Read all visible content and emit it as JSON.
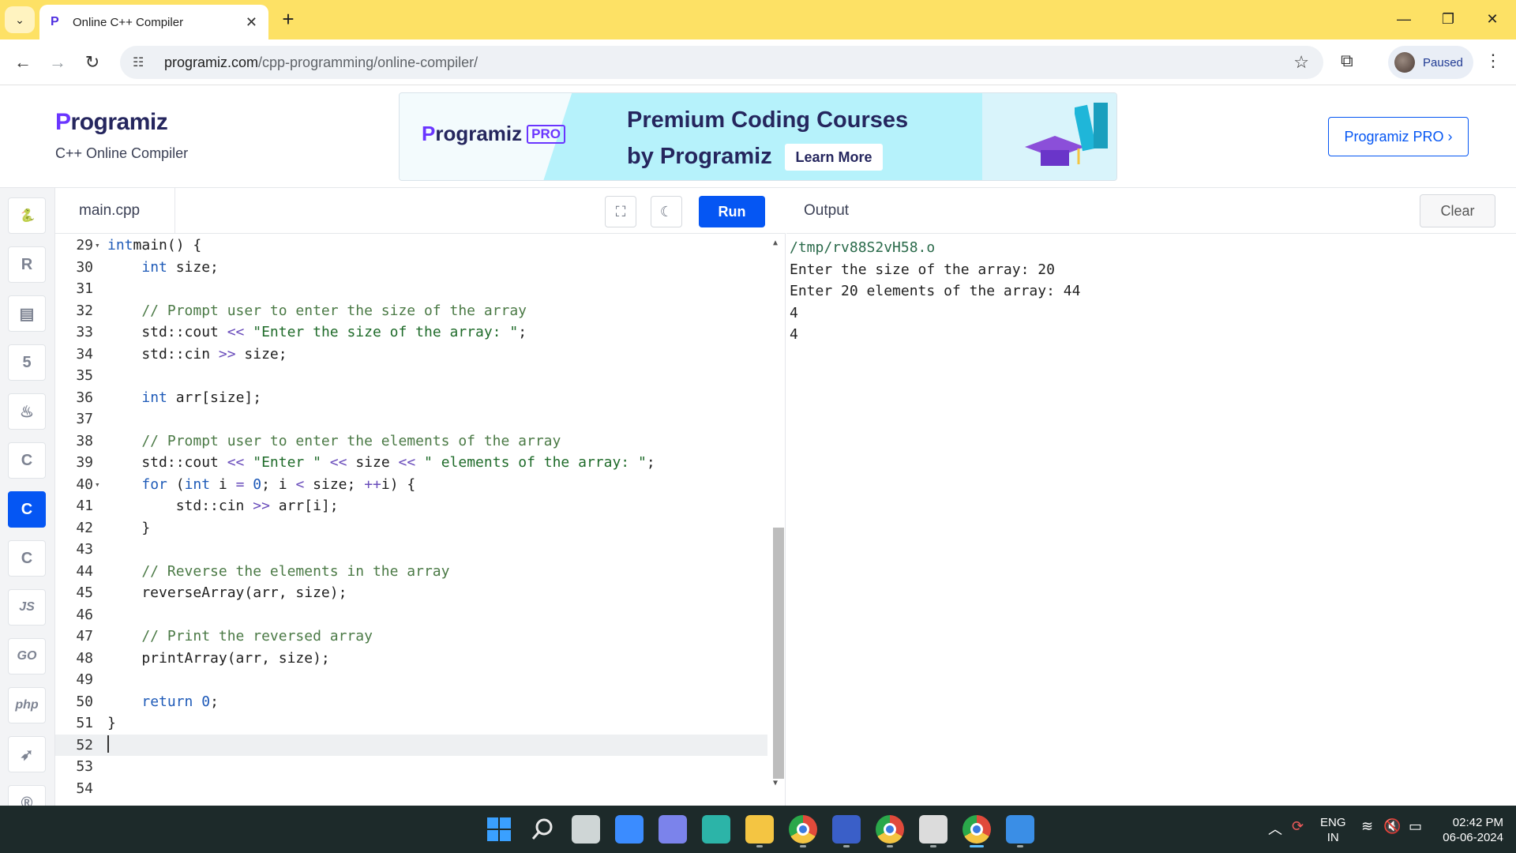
{
  "browser": {
    "tab_title": "Online C++ Compiler",
    "url_domain": "programiz.com",
    "url_path": "/cpp-programming/online-compiler/",
    "profile_status": "Paused",
    "titlebar_color": "#fde165"
  },
  "site": {
    "logo": "rogramiz",
    "logo_letter": "P",
    "subtitle": "C++ Online Compiler",
    "banner": {
      "logo": "rogramiz",
      "logo_letter": "P",
      "badge": "PRO",
      "headline_1": "Premium Coding Courses",
      "headline_2": "by Programiz",
      "cta": "Learn More"
    },
    "pro_button": "Programiz PRO ›"
  },
  "rail": {
    "languages": [
      {
        "name": "python-icon",
        "glyph": "🐍"
      },
      {
        "name": "r-icon",
        "glyph": "R"
      },
      {
        "name": "sql-icon",
        "glyph": "▤"
      },
      {
        "name": "html-icon",
        "glyph": "5"
      },
      {
        "name": "java-icon",
        "glyph": "♨"
      },
      {
        "name": "c-icon",
        "glyph": "C"
      },
      {
        "name": "cpp-icon",
        "glyph": "C",
        "active": true
      },
      {
        "name": "csharp-icon",
        "glyph": "C"
      },
      {
        "name": "js-icon",
        "glyph": "JS"
      },
      {
        "name": "go-icon",
        "glyph": "GO"
      },
      {
        "name": "php-icon",
        "glyph": "php"
      },
      {
        "name": "swift-icon",
        "glyph": "➶"
      },
      {
        "name": "rust-icon",
        "glyph": "®"
      }
    ]
  },
  "editor": {
    "file_name": "main.cpp",
    "run_label": "Run",
    "accent": "#0556f3",
    "current_line": 52,
    "lines": [
      {
        "n": "29",
        "fold": true,
        "tokens": [
          [
            "kw",
            "int"
          ],
          [
            "",
            "main() {"
          ]
        ]
      },
      {
        "n": "30",
        "fold": false,
        "tokens": [
          [
            "",
            "    "
          ],
          [
            "kw",
            "int"
          ],
          [
            "",
            " size;"
          ]
        ]
      },
      {
        "n": "31",
        "fold": false,
        "tokens": []
      },
      {
        "n": "32",
        "fold": false,
        "tokens": [
          [
            "com",
            "    // Prompt user to enter the size of the array"
          ]
        ]
      },
      {
        "n": "33",
        "fold": false,
        "tokens": [
          [
            "",
            "    std::cout "
          ],
          [
            "op",
            "<<"
          ],
          [
            "str",
            " \"Enter the size of the array: \""
          ],
          [
            "",
            ";"
          ]
        ]
      },
      {
        "n": "34",
        "fold": false,
        "tokens": [
          [
            "",
            "    std::cin "
          ],
          [
            "op",
            ">>"
          ],
          [
            "",
            " size;"
          ]
        ]
      },
      {
        "n": "35",
        "fold": false,
        "tokens": []
      },
      {
        "n": "36",
        "fold": false,
        "tokens": [
          [
            "",
            "    "
          ],
          [
            "kw",
            "int"
          ],
          [
            "",
            " arr[size];"
          ]
        ]
      },
      {
        "n": "37",
        "fold": false,
        "tokens": []
      },
      {
        "n": "38",
        "fold": false,
        "tokens": [
          [
            "com",
            "    // Prompt user to enter the elements of the array"
          ]
        ]
      },
      {
        "n": "39",
        "fold": false,
        "tokens": [
          [
            "",
            "    std::cout "
          ],
          [
            "op",
            "<<"
          ],
          [
            "str",
            " \"Enter \""
          ],
          [
            "",
            " "
          ],
          [
            "op",
            "<<"
          ],
          [
            "",
            " size "
          ],
          [
            "op",
            "<<"
          ],
          [
            "str",
            " \" elements of the array: \""
          ],
          [
            "",
            ";"
          ]
        ]
      },
      {
        "n": "40",
        "fold": true,
        "tokens": [
          [
            "",
            "    "
          ],
          [
            "kw",
            "for"
          ],
          [
            "",
            " ("
          ],
          [
            "kw",
            "int"
          ],
          [
            "",
            " i "
          ],
          [
            "op",
            "="
          ],
          [
            "",
            " "
          ],
          [
            "num",
            "0"
          ],
          [
            "",
            "; i "
          ],
          [
            "op",
            "<"
          ],
          [
            "",
            " size; "
          ],
          [
            "op",
            "++"
          ],
          [
            "",
            "i) {"
          ]
        ]
      },
      {
        "n": "41",
        "fold": false,
        "tokens": [
          [
            "",
            "        std::cin "
          ],
          [
            "op",
            ">>"
          ],
          [
            "",
            " arr[i];"
          ]
        ]
      },
      {
        "n": "42",
        "fold": false,
        "tokens": [
          [
            "",
            "    }"
          ]
        ]
      },
      {
        "n": "43",
        "fold": false,
        "tokens": []
      },
      {
        "n": "44",
        "fold": false,
        "tokens": [
          [
            "com",
            "    // Reverse the elements in the array"
          ]
        ]
      },
      {
        "n": "45",
        "fold": false,
        "tokens": [
          [
            "",
            "    reverseArray(arr, size);"
          ]
        ]
      },
      {
        "n": "46",
        "fold": false,
        "tokens": []
      },
      {
        "n": "47",
        "fold": false,
        "tokens": [
          [
            "com",
            "    // Print the reversed array"
          ]
        ]
      },
      {
        "n": "48",
        "fold": false,
        "tokens": [
          [
            "",
            "    printArray(arr, size);"
          ]
        ]
      },
      {
        "n": "49",
        "fold": false,
        "tokens": []
      },
      {
        "n": "50",
        "fold": false,
        "tokens": [
          [
            "",
            "    "
          ],
          [
            "kw",
            "return"
          ],
          [
            "",
            " "
          ],
          [
            "num",
            "0"
          ],
          [
            "",
            ";"
          ]
        ]
      },
      {
        "n": "51",
        "fold": false,
        "tokens": [
          [
            "",
            "}"
          ]
        ]
      },
      {
        "n": "52",
        "fold": false,
        "tokens": []
      },
      {
        "n": "53",
        "fold": false,
        "tokens": []
      },
      {
        "n": "54",
        "fold": false,
        "tokens": []
      }
    ]
  },
  "output": {
    "title": "Output",
    "clear_label": "Clear",
    "lines": [
      "/tmp/rv88S2vH58.o",
      "Enter the size of the array: 20",
      "Enter 20 elements of the array: 44",
      "4",
      "4"
    ]
  },
  "taskbar": {
    "apps": [
      {
        "name": "start-icon",
        "color": "#3aa0ff"
      },
      {
        "name": "search-icon",
        "color": "#e8e8e8"
      },
      {
        "name": "task-view-icon",
        "color": "#cfd6d6"
      },
      {
        "name": "widgets-icon",
        "color": "#3b8cff"
      },
      {
        "name": "teams-chat-icon",
        "color": "#7b83eb"
      },
      {
        "name": "edge-icon",
        "color": "#2cb4a8"
      },
      {
        "name": "file-explorer-icon",
        "color": "#f4c542"
      },
      {
        "name": "chrome-icon",
        "color": "#e04a3b"
      },
      {
        "name": "dev-icon",
        "color": "#3a5fc8"
      },
      {
        "name": "chrome-profile-icon",
        "color": "#e04a3b"
      },
      {
        "name": "app-icon",
        "color": "#dcdcdc"
      },
      {
        "name": "chrome-active-icon",
        "color": "#e04a3b"
      },
      {
        "name": "photos-icon",
        "color": "#3a8ee6"
      }
    ],
    "lang_line1": "ENG",
    "lang_line2": "IN",
    "time": "02:42 PM",
    "date": "06-06-2024"
  }
}
